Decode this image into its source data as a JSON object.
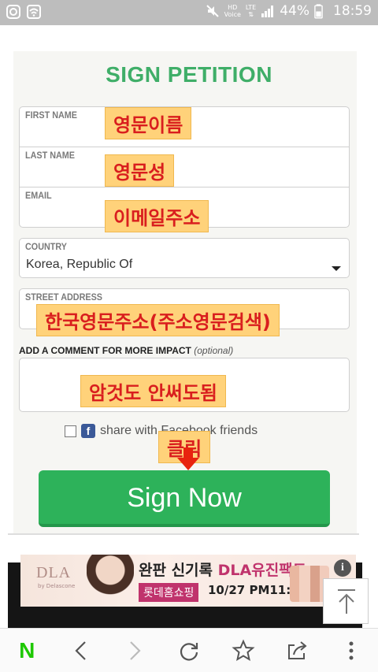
{
  "status_bar": {
    "volte_top": "HD",
    "volte_bottom": "Voice",
    "network_type": "LTE",
    "battery": "44%",
    "time": "18:59"
  },
  "form": {
    "title": "SIGN PETITION",
    "first_name_label": "FIRST NAME",
    "last_name_label": "LAST NAME",
    "email_label": "EMAIL",
    "country_label": "COUNTRY",
    "country_value": "Korea, Republic Of",
    "street_label": "STREET ADDRESS",
    "comment_label": "ADD A COMMENT FOR MORE IMPACT",
    "comment_optional": "(optional)",
    "share_label": "share with Facebook friends",
    "submit_label": "Sign Now"
  },
  "annotations": {
    "first_name": "영문이름",
    "last_name": "영문성",
    "email": "이메일주소",
    "street": "한국영문주소(주소영문검색)",
    "comment": "암것도 안써도됨",
    "click": "클릭"
  },
  "ad": {
    "brand": "DLA",
    "brand_sub": "by Delascone",
    "headline_prefix": "완판 신기록 ",
    "headline_accent": "DLA유진팩트",
    "shop": "롯데홈쇼핑",
    "datetime": "10/27 PM11:50",
    "info_icon": "info-icon"
  },
  "colors": {
    "accent_green": "#2db25a",
    "title_green": "#3fae68",
    "annotation_bg": "#ffd27a",
    "annotation_text": "#d91e1e",
    "arrow_red": "#e8230f"
  }
}
